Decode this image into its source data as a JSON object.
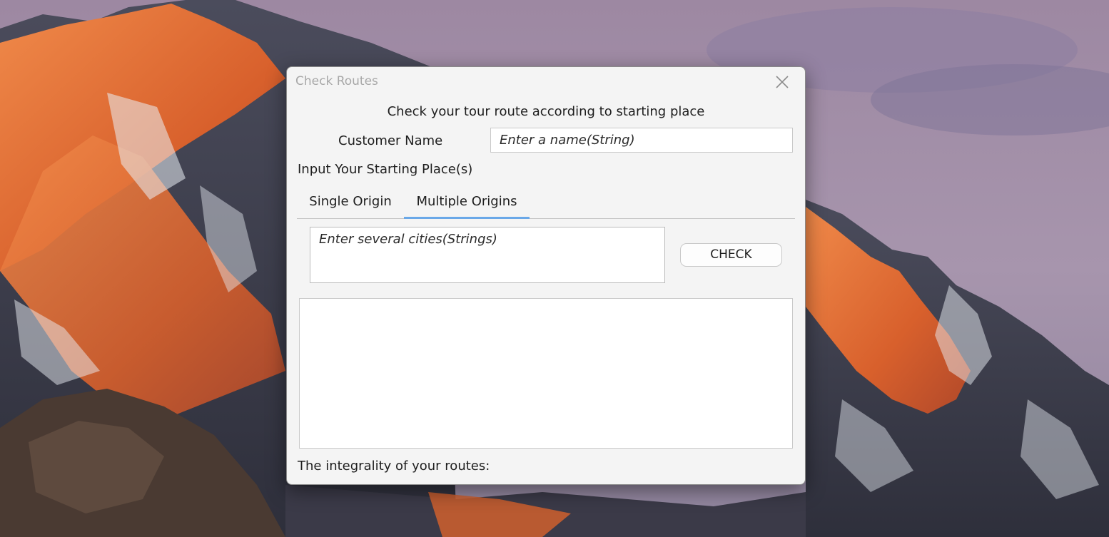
{
  "window": {
    "title": "Check Routes"
  },
  "main": {
    "heading": "Check your tour route according to starting place",
    "customer_label": "Customer Name",
    "customer_placeholder": "Enter a name(String)",
    "starting_label": "Input Your Starting Place(s)",
    "tabs": [
      {
        "label": "Single Origin",
        "selected": false
      },
      {
        "label": "Multiple Origins",
        "selected": true
      }
    ],
    "cities_placeholder": "Enter several cities(Strings)",
    "check_label": "CHECK",
    "result_text": "",
    "integrality_label": "The integrality of your routes:"
  },
  "icons": {
    "close": "close-icon"
  },
  "colors": {
    "tab_accent": "#6aa8e8",
    "dialog_bg": "#f4f4f4"
  }
}
